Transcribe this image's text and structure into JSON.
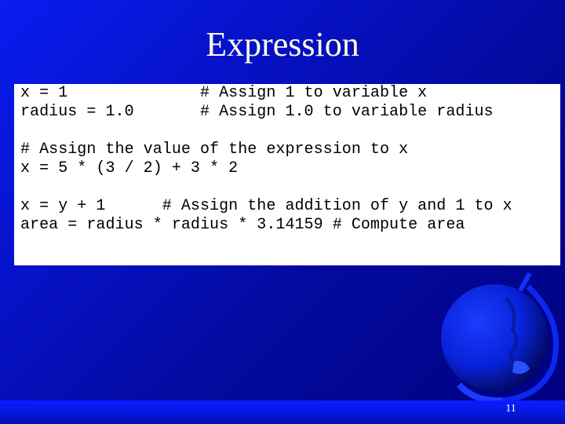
{
  "slide": {
    "title": "Expression",
    "page_number": "11"
  },
  "code": {
    "lines": [
      "x = 1              # Assign 1 to variable x",
      "radius = 1.0       # Assign 1.0 to variable radius",
      "",
      "# Assign the value of the expression to x",
      "x = 5 * (3 / 2) + 3 * 2",
      "",
      "x = y + 1      # Assign the addition of y and 1 to x",
      "area = radius * radius * 3.14159 # Compute area"
    ]
  },
  "decorations": {
    "globe": "globe-icon"
  }
}
